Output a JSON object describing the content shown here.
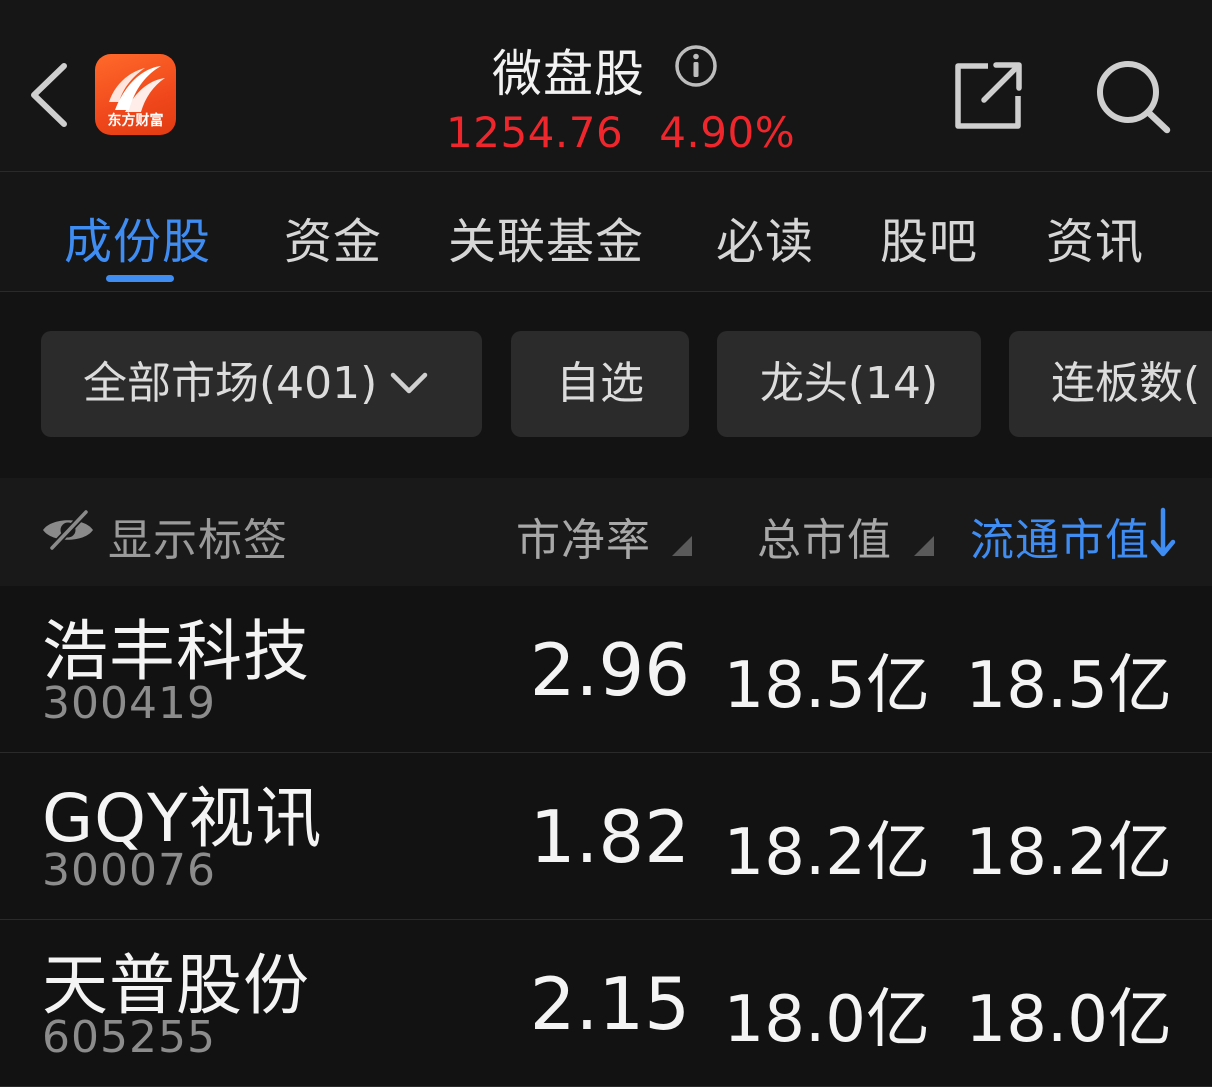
{
  "header": {
    "title": "微盘股",
    "price": "1254.76",
    "change_pct": "4.90%",
    "logo_text": "东方财富",
    "colors": {
      "up": "#f0262d",
      "accent": "#3f8cf2",
      "logo": "#f0481c"
    },
    "icons": {
      "back": "chevron-left-icon",
      "info": "info-icon",
      "share": "share-icon",
      "search": "search-icon"
    }
  },
  "tabs": [
    {
      "label": "成份股",
      "active": true
    },
    {
      "label": "资金"
    },
    {
      "label": "关联基金"
    },
    {
      "label": "必读"
    },
    {
      "label": "股吧"
    },
    {
      "label": "资讯"
    }
  ],
  "filters": [
    {
      "label": "全部市场(401)",
      "has_dropdown": true
    },
    {
      "label": "自选"
    },
    {
      "label": "龙头(14)"
    },
    {
      "label": "连板数("
    }
  ],
  "table": {
    "show_tag_label": "显示标签",
    "columns": [
      {
        "label": "市净率"
      },
      {
        "label": "总市值"
      },
      {
        "label": "流通市值",
        "sorted": "desc"
      }
    ],
    "rows": [
      {
        "name": "浩丰科技",
        "code": "300419",
        "pb": "2.96",
        "market_cap": "18.5亿",
        "float_cap": "18.5亿"
      },
      {
        "name": "GQY视讯",
        "code": "300076",
        "pb": "1.82",
        "market_cap": "18.2亿",
        "float_cap": "18.2亿"
      },
      {
        "name": "天普股份",
        "code": "605255",
        "pb": "2.15",
        "market_cap": "18.0亿",
        "float_cap": "18.0亿"
      }
    ]
  }
}
